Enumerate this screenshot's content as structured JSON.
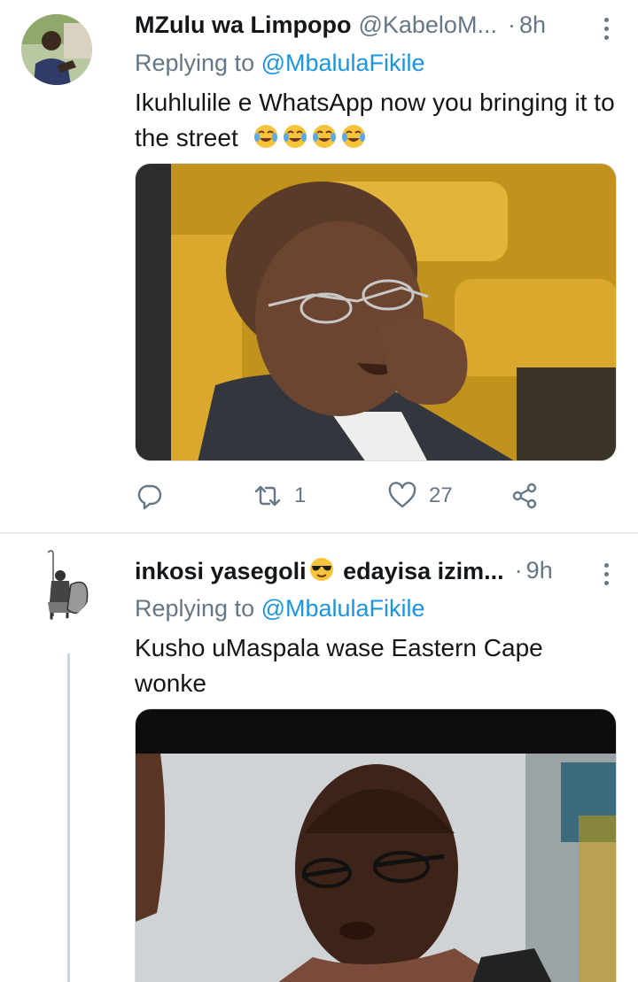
{
  "tweets": [
    {
      "display_name": "MZulu wa Limpopo",
      "handle": "@KabeloM...",
      "separator": "·",
      "time": "8h",
      "replying_prefix": "Replying to ",
      "replying_to": "@MbalulaFikile",
      "text": "Ikuhlulile e WhatsApp now you bringing it to the street",
      "text_emoji": "face-with-tears-of-joy",
      "text_emoji_count": 4,
      "retweets": "1",
      "likes": "27"
    },
    {
      "display_name_part1": "inkosi yasegoli",
      "name_emoji": "smiling-face-with-sunglasses",
      "display_name_part2": " edayisa izim...",
      "separator": "·",
      "time": "9h",
      "replying_prefix": "Replying to ",
      "replying_to": "@MbalulaFikile",
      "text": "Kusho uMaspala wase Eastern Cape wonke"
    }
  ],
  "icons": {
    "reply": "reply-icon",
    "retweet": "retweet-icon",
    "like": "heart-icon",
    "share": "share-icon",
    "more": "more-vertical-icon"
  },
  "colors": {
    "link": "#1b95e0",
    "muted": "#657786",
    "text": "#14171a",
    "divider": "#e6ecf0"
  }
}
